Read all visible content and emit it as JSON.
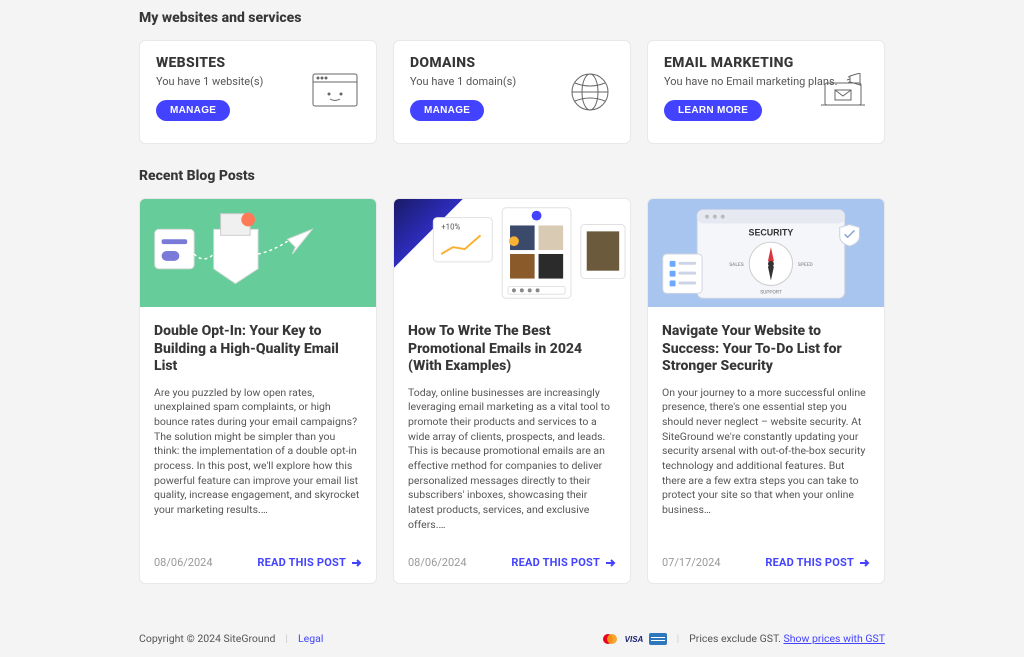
{
  "sections": {
    "services_title": "My websites and services",
    "blog_title": "Recent Blog Posts"
  },
  "services": {
    "websites": {
      "title": "WEBSITES",
      "sub": "You have 1 website(s)",
      "button": "MANAGE"
    },
    "domains": {
      "title": "DOMAINS",
      "sub": "You have 1 domain(s)",
      "button": "MANAGE"
    },
    "email": {
      "title": "EMAIL MARKETING",
      "sub": "You have no Email marketing plans.",
      "button": "LEARN MORE"
    }
  },
  "posts": [
    {
      "title": "Double Opt-In: Your Key to Building a High-Quality Email List",
      "excerpt": "Are you puzzled by low open rates, unexplained spam complaints, or high bounce rates during your email campaigns? The solution might be simpler than you think: the implementation of a double opt-in process. In this post, we'll explore how this powerful feature can improve your email list quality, increase engagement, and skyrocket your marketing results.…",
      "date": "08/06/2024",
      "link": "READ THIS POST"
    },
    {
      "title": "How To Write The Best Promotional Emails in 2024 (With Examples)",
      "excerpt": "Today, online businesses are increasingly leveraging email marketing as a vital tool to promote their products and services to a wide array of clients, prospects, and leads. This is because promotional emails are an effective method for companies to deliver personalized messages directly to their subscribers' inboxes, showcasing their latest products, services, and exclusive offers.…",
      "date": "08/06/2024",
      "link": "READ THIS POST"
    },
    {
      "title": "Navigate Your Website to Success: Your To-Do List for Stronger Security",
      "excerpt": "On your journey to a more successful online presence, there's one essential step you should never neglect – website security. At SiteGround we're constantly updating your security arsenal with out-of-the-box security technology and additional features. But there are a few extra steps you can take to protect your site so that when your online business…",
      "date": "07/17/2024",
      "link": "READ THIS POST"
    }
  ],
  "footer": {
    "copyright": "Copyright © 2024 SiteGround",
    "legal": "Legal",
    "prices_prefix": "Prices exclude GST. ",
    "prices_link": "Show prices with GST",
    "separator": "|"
  }
}
